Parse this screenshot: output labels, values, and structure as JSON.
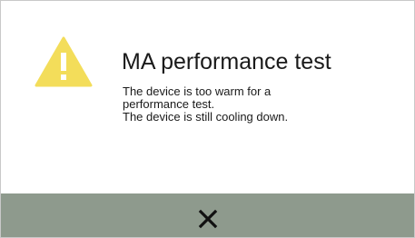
{
  "dialog": {
    "title": "MA performance test",
    "message_lines": [
      "The device is too warm for a",
      "performance test.",
      "The device is still cooling down."
    ],
    "icon": "warning-icon",
    "close_icon": "close-icon"
  },
  "colors": {
    "warning": "#f3dd5a",
    "footer": "#8e9a8d",
    "text": "#1a1a1a"
  }
}
